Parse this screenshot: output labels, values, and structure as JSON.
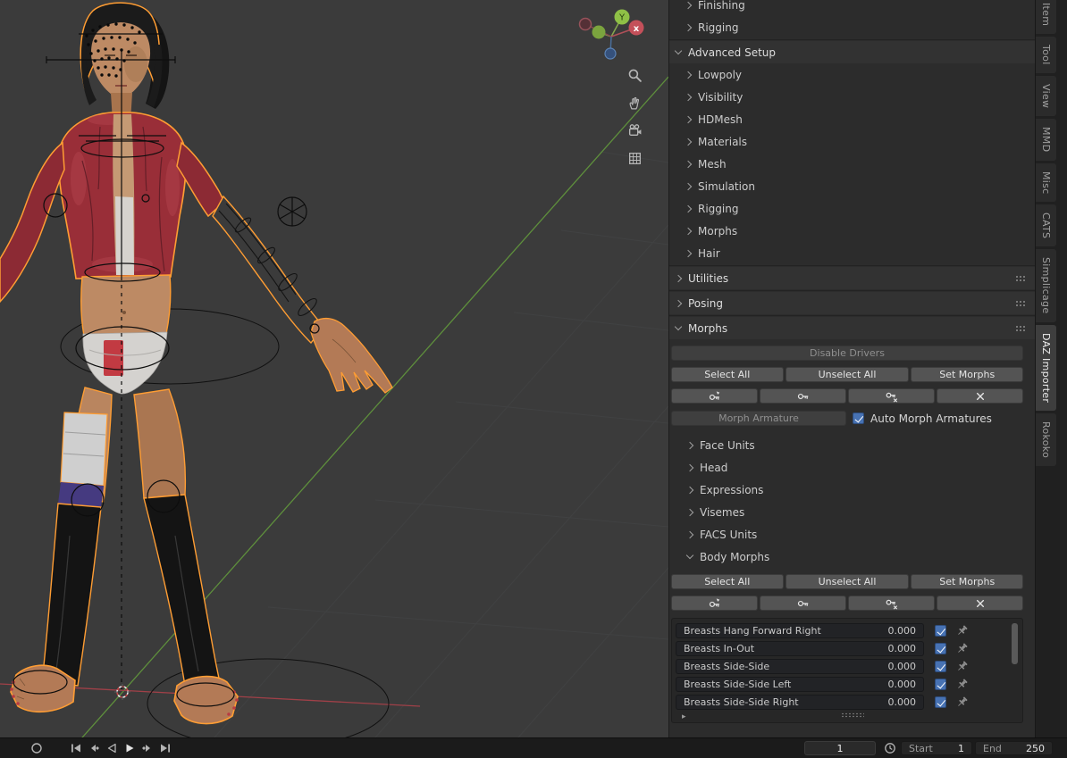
{
  "app": {
    "name": "Blender 3D Viewport with DAZ Importer sidebar"
  },
  "viewport": {
    "gizmo": {
      "y_label": "Y",
      "x_label": "x"
    },
    "tool_icons": [
      "zoom",
      "pan",
      "camera",
      "grid"
    ]
  },
  "sidebar": {
    "rows": [
      {
        "label": "Finishing",
        "type": "sub",
        "expanded": false
      },
      {
        "label": "Rigging",
        "type": "sub",
        "expanded": false
      },
      {
        "label": "Advanced Setup",
        "type": "header",
        "expanded": true
      },
      {
        "label": "Lowpoly",
        "type": "sub",
        "expanded": false
      },
      {
        "label": "Visibility",
        "type": "sub",
        "expanded": false
      },
      {
        "label": "HDMesh",
        "type": "sub",
        "expanded": false
      },
      {
        "label": "Materials",
        "type": "sub",
        "expanded": false
      },
      {
        "label": "Mesh",
        "type": "sub",
        "expanded": false
      },
      {
        "label": "Simulation",
        "type": "sub",
        "expanded": false
      },
      {
        "label": "Rigging",
        "type": "sub",
        "expanded": false
      },
      {
        "label": "Morphs",
        "type": "sub",
        "expanded": false
      },
      {
        "label": "Hair",
        "type": "sub",
        "expanded": false
      },
      {
        "label": "Utilities",
        "type": "header",
        "expanded": false
      },
      {
        "label": "Posing",
        "type": "header",
        "expanded": false
      },
      {
        "label": "Morphs",
        "type": "header",
        "expanded": true
      }
    ],
    "morphs": {
      "disable_drivers": "Disable Drivers",
      "select_all": "Select All",
      "unselect_all": "Unselect All",
      "set_morphs": "Set Morphs",
      "morph_armature": "Morph Armature",
      "auto_morph_armatures": "Auto Morph Armatures",
      "auto_morph_checked": true,
      "action_icons": [
        "keying-set",
        "key-morphs",
        "unkey-morphs",
        "clear-morphs"
      ],
      "subpanels": [
        {
          "label": "Face Units",
          "expanded": false
        },
        {
          "label": "Head",
          "expanded": false
        },
        {
          "label": "Expressions",
          "expanded": false
        },
        {
          "label": "Visemes",
          "expanded": false
        },
        {
          "label": "FACS Units",
          "expanded": false
        },
        {
          "label": "Body Morphs",
          "expanded": true
        }
      ],
      "body_morphs": {
        "select_all": "Select All",
        "unselect_all": "Unselect All",
        "set_morphs": "Set Morphs",
        "sliders": [
          {
            "name": "Breasts Hang Forward Right",
            "value": "0.000",
            "enabled": true
          },
          {
            "name": "Breasts In-Out",
            "value": "0.000",
            "enabled": true
          },
          {
            "name": "Breasts Side-Side",
            "value": "0.000",
            "enabled": true
          },
          {
            "name": "Breasts Side-Side Left",
            "value": "0.000",
            "enabled": true
          },
          {
            "name": "Breasts Side-Side Right",
            "value": "0.000",
            "enabled": true
          }
        ]
      }
    },
    "tabs": [
      {
        "label": "Item",
        "active": false
      },
      {
        "label": "Tool",
        "active": false
      },
      {
        "label": "View",
        "active": false
      },
      {
        "label": "MMD",
        "active": false
      },
      {
        "label": "Misc",
        "active": false
      },
      {
        "label": "CATS",
        "active": false
      },
      {
        "label": "Simplicage",
        "active": false
      },
      {
        "label": "DAZ Importer",
        "active": true
      },
      {
        "label": "Rokoko",
        "active": false
      }
    ]
  },
  "timeline": {
    "current_frame": "1",
    "start_label": "Start",
    "start_value": "1",
    "end_label": "End",
    "end_value": "250",
    "playback_icons": [
      "jump-to-start",
      "previous-keyframe",
      "play-reverse",
      "play",
      "next-keyframe",
      "jump-to-end"
    ]
  },
  "colors": {
    "accent_blue": "#4772b3",
    "selection_orange": "#ff9d33",
    "axis_green": "#5e8f3c",
    "axis_red": "#a04048",
    "panel_bg": "#2c2c2c",
    "viewport_bg": "#3b3b3b"
  }
}
